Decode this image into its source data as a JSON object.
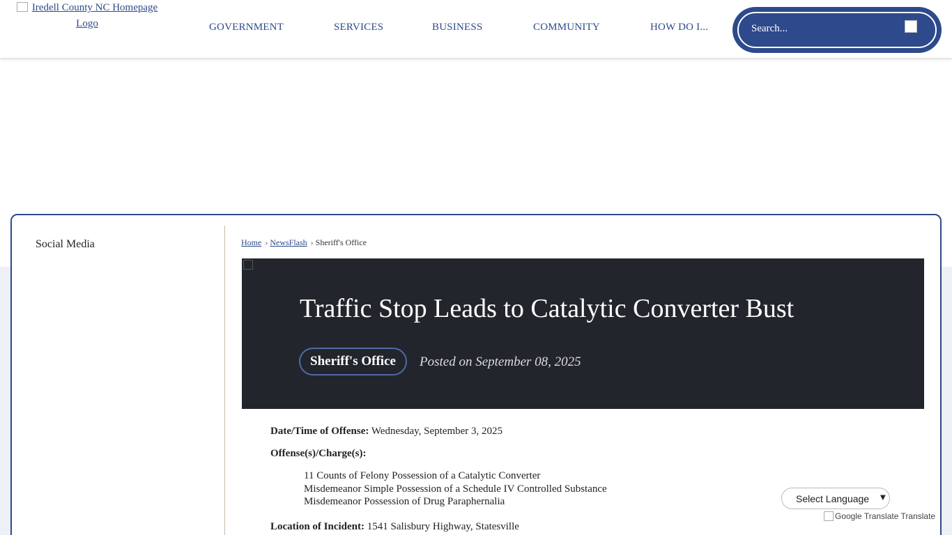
{
  "header": {
    "logo_alt": "Iredell County NC Homepage Logo",
    "nav": [
      "GOVERNMENT",
      "SERVICES",
      "BUSINESS",
      "COMMUNITY",
      "HOW DO I..."
    ],
    "search_placeholder": "Search..."
  },
  "sidebar": {
    "label": "Social Media"
  },
  "breadcrumb": {
    "home": "Home",
    "newsflash": "NewsFlash",
    "current": "Sheriff's Office"
  },
  "article": {
    "title": "Traffic Stop Leads to Catalytic Converter Bust",
    "category": "Sheriff's Office",
    "posted": "Posted on September 08, 2025",
    "date_label": "Date/Time of Offense:",
    "date_value": "Wednesday, September 3, 2025",
    "charges_label": "Offense(s)/Charge(s):",
    "charges": [
      "11 Counts of Felony Possession of a Catalytic Converter",
      "Misdemeanor Simple Possession of a Schedule IV Controlled Substance",
      "Misdemeanor Possession of Drug Paraphernalia"
    ],
    "location_label": "Location of Incident:",
    "location_value": "1541 Salisbury Highway, Statesville"
  },
  "translate": {
    "select_label": "Select Language",
    "credit_alt": "Google Translate",
    "credit_text": "Translate"
  },
  "colors": {
    "brand_blue": "#2e4a8c",
    "hero_bg": "#22262c",
    "band_bg": "#edf0f5"
  }
}
